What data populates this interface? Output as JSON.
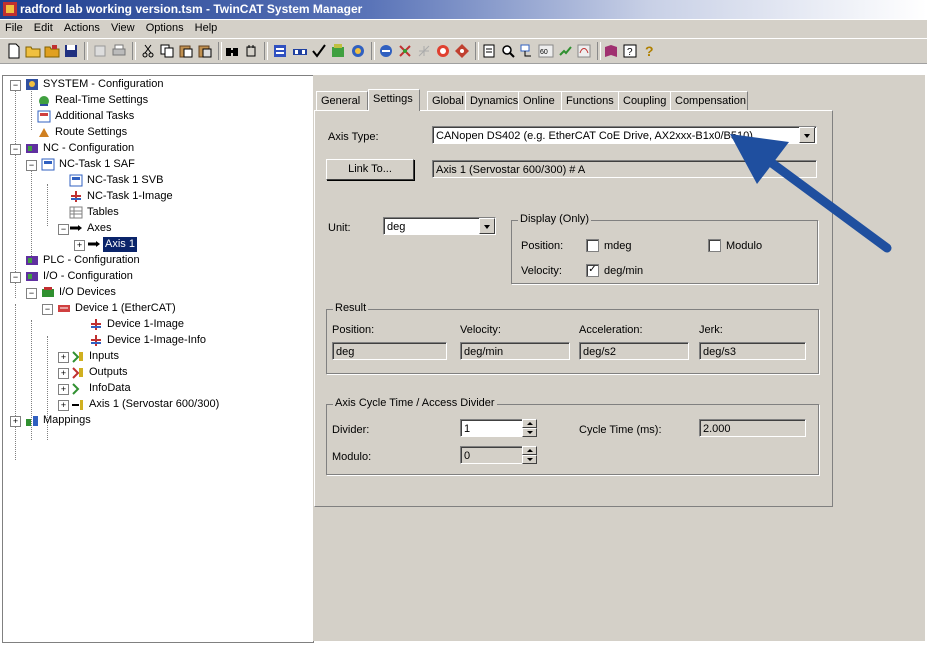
{
  "window": {
    "title": "radford lab working version.tsm - TwinCAT System Manager"
  },
  "menu": [
    "File",
    "Edit",
    "Actions",
    "View",
    "Options",
    "Help"
  ],
  "toolbar_icons": [
    "new-file-icon",
    "open-folder-icon",
    "open-project-icon",
    "save-icon",
    "print-preview-icon",
    "print-icon",
    "cut-icon",
    "copy-icon",
    "paste-icon",
    "paste-with-links-icon",
    "find-icon",
    "find-next-icon",
    "generate-mappings-icon",
    "check-configuration-icon",
    "activate-configuration-icon",
    "set-run-mode-icon",
    "restart-config-mode-icon",
    "reload-devices-icon",
    "scan-devices-icon",
    "toggle-free-run-icon",
    "change-netid-icon",
    "target-system-icon",
    "show-online-data-icon",
    "zoom-icon",
    "show-sub-items-icon",
    "scope-icon",
    "plc-login-icon",
    "plc-logout-icon",
    "help-book-icon",
    "about-icon",
    "context-help-icon"
  ],
  "tree": {
    "items": [
      {
        "label": "SYSTEM - Configuration",
        "icon": "system-config-icon"
      },
      {
        "label": "Real-Time Settings",
        "icon": "realtime-settings-icon"
      },
      {
        "label": "Additional Tasks",
        "icon": "additional-tasks-icon"
      },
      {
        "label": "Route Settings",
        "icon": "route-settings-icon"
      },
      {
        "label": "NC - Configuration",
        "icon": "nc-config-icon"
      },
      {
        "label": "NC-Task 1 SAF",
        "icon": "nc-task-icon"
      },
      {
        "label": "NC-Task 1 SVB",
        "icon": "nc-task-svb-icon"
      },
      {
        "label": "NC-Task 1-Image",
        "icon": "process-image-icon"
      },
      {
        "label": "Tables",
        "icon": "tables-icon"
      },
      {
        "label": "Axes",
        "icon": "axes-icon"
      },
      {
        "label": "Axis 1",
        "icon": "axis-icon"
      },
      {
        "label": "PLC - Configuration",
        "icon": "plc-config-icon"
      },
      {
        "label": "I/O - Configuration",
        "icon": "io-config-icon"
      },
      {
        "label": "I/O Devices",
        "icon": "io-devices-icon"
      },
      {
        "label": "Device 1 (EtherCAT)",
        "icon": "ethercat-device-icon"
      },
      {
        "label": "Device 1-Image",
        "icon": "process-image-icon"
      },
      {
        "label": "Device 1-Image-Info",
        "icon": "process-image-icon"
      },
      {
        "label": "Inputs",
        "icon": "inputs-icon"
      },
      {
        "label": "Outputs",
        "icon": "outputs-icon"
      },
      {
        "label": "InfoData",
        "icon": "infodata-icon"
      },
      {
        "label": "Axis 1 (Servostar 600/300)",
        "icon": "servo-drive-icon"
      },
      {
        "label": "Mappings",
        "icon": "mappings-icon"
      }
    ]
  },
  "tabs": [
    "General",
    "Settings",
    "Global",
    "Dynamics",
    "Online",
    "Functions",
    "Coupling",
    "Compensation"
  ],
  "active_tab": "Settings",
  "settings": {
    "axis_type_label": "Axis Type:",
    "axis_type_value": "CANopen DS402  (e.g. EtherCAT CoE Drive, AX2xxx-B1x0/B510)",
    "link_to_button": "Link To...",
    "link_to_value": "Axis 1 (Servostar 600/300) # A",
    "unit_label": "Unit:",
    "unit_value": "deg",
    "display_group": "Display (Only)",
    "position_label": "Position:",
    "mdeg_label": "mdeg",
    "mdeg_checked": false,
    "modulo_label": "Modulo",
    "modulo_checked": false,
    "velocity_label": "Velocity:",
    "degmin_label": "deg/min",
    "degmin_checked": true,
    "result_group": "Result",
    "result_position_label": "Position:",
    "result_velocity_label": "Velocity:",
    "result_acceleration_label": "Acceleration:",
    "result_jerk_label": "Jerk:",
    "result_position_value": "deg",
    "result_velocity_value": "deg/min",
    "result_acceleration_value": "deg/s2",
    "result_jerk_value": "deg/s3",
    "cycle_group": "Axis Cycle Time / Access Divider",
    "divider_label": "Divider:",
    "divider_value": "1",
    "cycle_time_label": "Cycle Time (ms):",
    "cycle_time_value": "2.000",
    "modulo_field_label": "Modulo:",
    "modulo_field_value": "0"
  },
  "colors": {
    "annotation_arrow": "#1f4f9f",
    "selection": "#0a246a",
    "face": "#d4d0c8"
  }
}
